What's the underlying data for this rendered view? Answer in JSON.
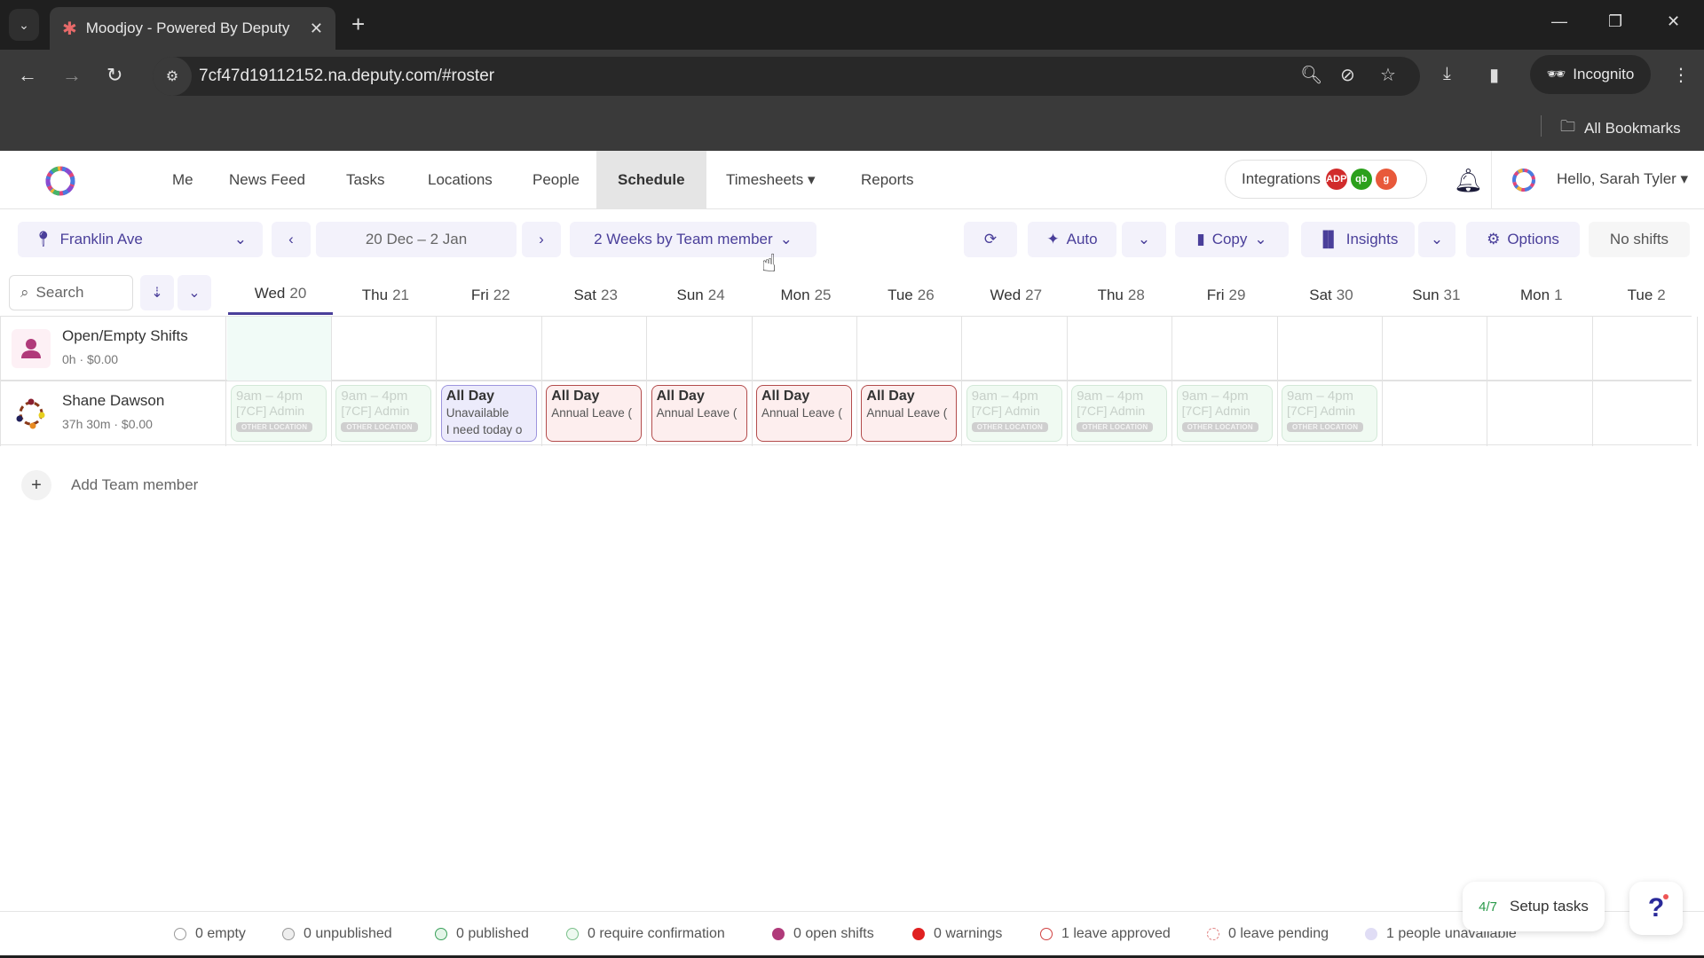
{
  "browser": {
    "tab_title": "Moodjoy - Powered By Deputy",
    "url": "7cf47d19112152.na.deputy.com/#roster",
    "incognito_label": "Incognito",
    "bookmarks_label": "All Bookmarks"
  },
  "header": {
    "menu": [
      {
        "label": "Me"
      },
      {
        "label": "News Feed"
      },
      {
        "label": "Tasks"
      },
      {
        "label": "Locations"
      },
      {
        "label": "People"
      },
      {
        "label": "Schedule",
        "active": true
      },
      {
        "label": "Timesheets ▾"
      },
      {
        "label": "Reports"
      }
    ],
    "integrations_label": "Integrations",
    "integration_badges": [
      {
        "label": "ADP",
        "color": "#d12b2b"
      },
      {
        "label": "qb",
        "color": "#2ca01c"
      },
      {
        "label": "g",
        "color": "#e8593a"
      }
    ],
    "greeting": "Hello, Sarah Tyler ▾"
  },
  "toolbar": {
    "location": "Franklin Ave",
    "date_range": "20 Dec – 2 Jan",
    "view": "2 Weeks by Team member",
    "auto_label": "Auto",
    "copy_label": "Copy",
    "insights_label": "Insights",
    "options_label": "Options",
    "no_shifts_label": "No shifts",
    "search_placeholder": "Search"
  },
  "days": [
    {
      "dow": "Wed",
      "num": "20",
      "today": true
    },
    {
      "dow": "Thu",
      "num": "21"
    },
    {
      "dow": "Fri",
      "num": "22"
    },
    {
      "dow": "Sat",
      "num": "23"
    },
    {
      "dow": "Sun",
      "num": "24"
    },
    {
      "dow": "Mon",
      "num": "25"
    },
    {
      "dow": "Tue",
      "num": "26"
    },
    {
      "dow": "Wed",
      "num": "27"
    },
    {
      "dow": "Thu",
      "num": "28"
    },
    {
      "dow": "Fri",
      "num": "29"
    },
    {
      "dow": "Sat",
      "num": "30"
    },
    {
      "dow": "Sun",
      "num": "31"
    },
    {
      "dow": "Mon",
      "num": "1"
    },
    {
      "dow": "Tue",
      "num": "2"
    }
  ],
  "rows": [
    {
      "name": "Open/Empty Shifts",
      "summary": "0h · $0.00",
      "shifts": []
    },
    {
      "name": "Shane Dawson",
      "summary": "37h 30m · $0.00",
      "shifts": [
        {
          "day": 0,
          "type": "other",
          "time": "9am – 4pm",
          "role": "[7CF] Admin",
          "tag": "OTHER LOCATION"
        },
        {
          "day": 1,
          "type": "other",
          "time": "9am – 4pm",
          "role": "[7CF] Admin",
          "tag": "OTHER LOCATION"
        },
        {
          "day": 2,
          "type": "unavail",
          "title": "All Day",
          "line1": "Unavailable",
          "line2": "I need today o"
        },
        {
          "day": 3,
          "type": "leave",
          "title": "All Day",
          "line1": "Annual Leave ("
        },
        {
          "day": 4,
          "type": "leave",
          "title": "All Day",
          "line1": "Annual Leave ("
        },
        {
          "day": 5,
          "type": "leave",
          "title": "All Day",
          "line1": "Annual Leave ("
        },
        {
          "day": 6,
          "type": "leave",
          "title": "All Day",
          "line1": "Annual Leave ("
        },
        {
          "day": 7,
          "type": "other",
          "time": "9am – 4pm",
          "role": "[7CF] Admin",
          "tag": "OTHER LOCATION"
        },
        {
          "day": 8,
          "type": "other",
          "time": "9am – 4pm",
          "role": "[7CF] Admin",
          "tag": "OTHER LOCATION"
        },
        {
          "day": 9,
          "type": "other",
          "time": "9am – 4pm",
          "role": "[7CF] Admin",
          "tag": "OTHER LOCATION"
        },
        {
          "day": 10,
          "type": "other",
          "time": "9am – 4pm",
          "role": "[7CF] Admin",
          "tag": "OTHER LOCATION"
        }
      ]
    }
  ],
  "add_member_label": "Add Team member",
  "legend": [
    {
      "label": "0 empty",
      "style": "ring",
      "color": "#999999"
    },
    {
      "label": "0 unpublished",
      "style": "ring-fill",
      "color": "#999999",
      "fill": "#eeeeee"
    },
    {
      "label": "0 published",
      "style": "ring-fill",
      "color": "#3aa05a",
      "fill": "#e3f5e8"
    },
    {
      "label": "0 require confirmation",
      "style": "ring-fill",
      "color": "#7ac08a",
      "fill": "#eef9f0"
    },
    {
      "label": "0 open shifts",
      "style": "solid",
      "color": "#b03a7a"
    },
    {
      "label": "0 warnings",
      "style": "solid",
      "color": "#e02020"
    },
    {
      "label": "1 leave approved",
      "style": "ring",
      "color": "#d04040"
    },
    {
      "label": "0 leave pending",
      "style": "dashed",
      "color": "#e08080"
    },
    {
      "label": "1 people unavailable",
      "style": "solid",
      "color": "#e0ddf5"
    }
  ],
  "setup_tasks": {
    "count": "4/7",
    "label": "Setup tasks"
  },
  "help_label": "?"
}
